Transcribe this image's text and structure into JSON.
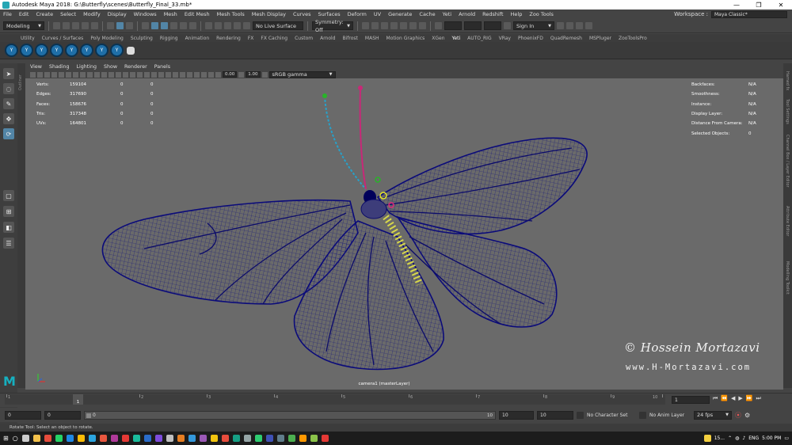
{
  "title": "Autodesk Maya 2018: G:\\Butterfly\\scenes\\Butterfly_Final_33.mb*",
  "menus": [
    "File",
    "Edit",
    "Create",
    "Select",
    "Modify",
    "Display",
    "Windows",
    "Mesh",
    "Edit Mesh",
    "Mesh Tools",
    "Mesh Display",
    "Curves",
    "Surfaces",
    "Deform",
    "UV",
    "Generate",
    "Cache",
    "Yeti",
    "Arnold",
    "Redshift",
    "Help",
    "Zoo Tools"
  ],
  "workspace": {
    "label": "Workspace :",
    "value": "Maya Classic*"
  },
  "statusline": {
    "mode": "Modeling",
    "live_surface": "No Live Surface",
    "symmetry": "Symmetry: Off",
    "sign_in": "Sign In"
  },
  "shelf_tabs": [
    "Utility",
    "Curves / Surfaces",
    "Poly Modeling",
    "Sculpting",
    "Rigging",
    "Animation",
    "Rendering",
    "FX",
    "FX Caching",
    "Custom",
    "Arnold",
    "Bifrost",
    "MASH",
    "Motion Graphics",
    "XGen",
    "Yeti",
    "AUTO_RIG",
    "VRay",
    "PhoenixFD",
    "QuadRemesh",
    "MSPluger",
    "ZooToolsPro"
  ],
  "active_shelf": "Yeti",
  "panel_menu": [
    "View",
    "Shading",
    "Lighting",
    "Show",
    "Renderer",
    "Panels"
  ],
  "panel_toolbar": {
    "exposure": "0.00",
    "gamma": "1.00",
    "color_space": "sRGB gamma"
  },
  "hud_left": [
    {
      "label": "Verts:",
      "v1": "159104",
      "v2": "0",
      "v3": "0"
    },
    {
      "label": "Edges:",
      "v1": "317690",
      "v2": "0",
      "v3": "0"
    },
    {
      "label": "Faces:",
      "v1": "158676",
      "v2": "0",
      "v3": "0"
    },
    {
      "label": "Tris:",
      "v1": "317348",
      "v2": "0",
      "v3": "0"
    },
    {
      "label": "UVs:",
      "v1": "164801",
      "v2": "0",
      "v3": "0"
    }
  ],
  "hud_right": [
    {
      "label": "Backfaces:",
      "value": "N/A"
    },
    {
      "label": "Smoothness:",
      "value": "N/A"
    },
    {
      "label": "Instance:",
      "value": "N/A"
    },
    {
      "label": "Display Layer:",
      "value": "N/A"
    },
    {
      "label": "Distance From Camera:",
      "value": "N/A"
    },
    {
      "label": "Selected Objects:",
      "value": "0"
    }
  ],
  "camera_label": "camera1 (masterLayer)",
  "watermark": {
    "name": "© Hossein Mortazavi",
    "url": "www.H-Mortazavi.com"
  },
  "right_tabs": [
    "Modelling Toolkit",
    "Attribute Editor",
    "Channel Box / Layer Editor",
    "Tool Settings",
    "Hamed fx"
  ],
  "outliner_tab": "Outliner",
  "timeline": {
    "ticks": [
      "1",
      "2",
      "3",
      "4",
      "5",
      "6",
      "7",
      "8",
      "9",
      "10"
    ],
    "current_frame": "1",
    "frame_field": "1"
  },
  "range": {
    "start": "0",
    "anim_start": "0",
    "slider_label": "0",
    "slider_end": "10",
    "anim_end": "10",
    "end": "10",
    "char_set": "No Character Set",
    "anim_layer": "No Anim Layer",
    "fps": "24 fps"
  },
  "help_line": "Rotate Tool: Select an object to rotate.",
  "taskbar": {
    "tray_text": "15...",
    "lang": "ENG",
    "clock": "5:00 PM"
  }
}
